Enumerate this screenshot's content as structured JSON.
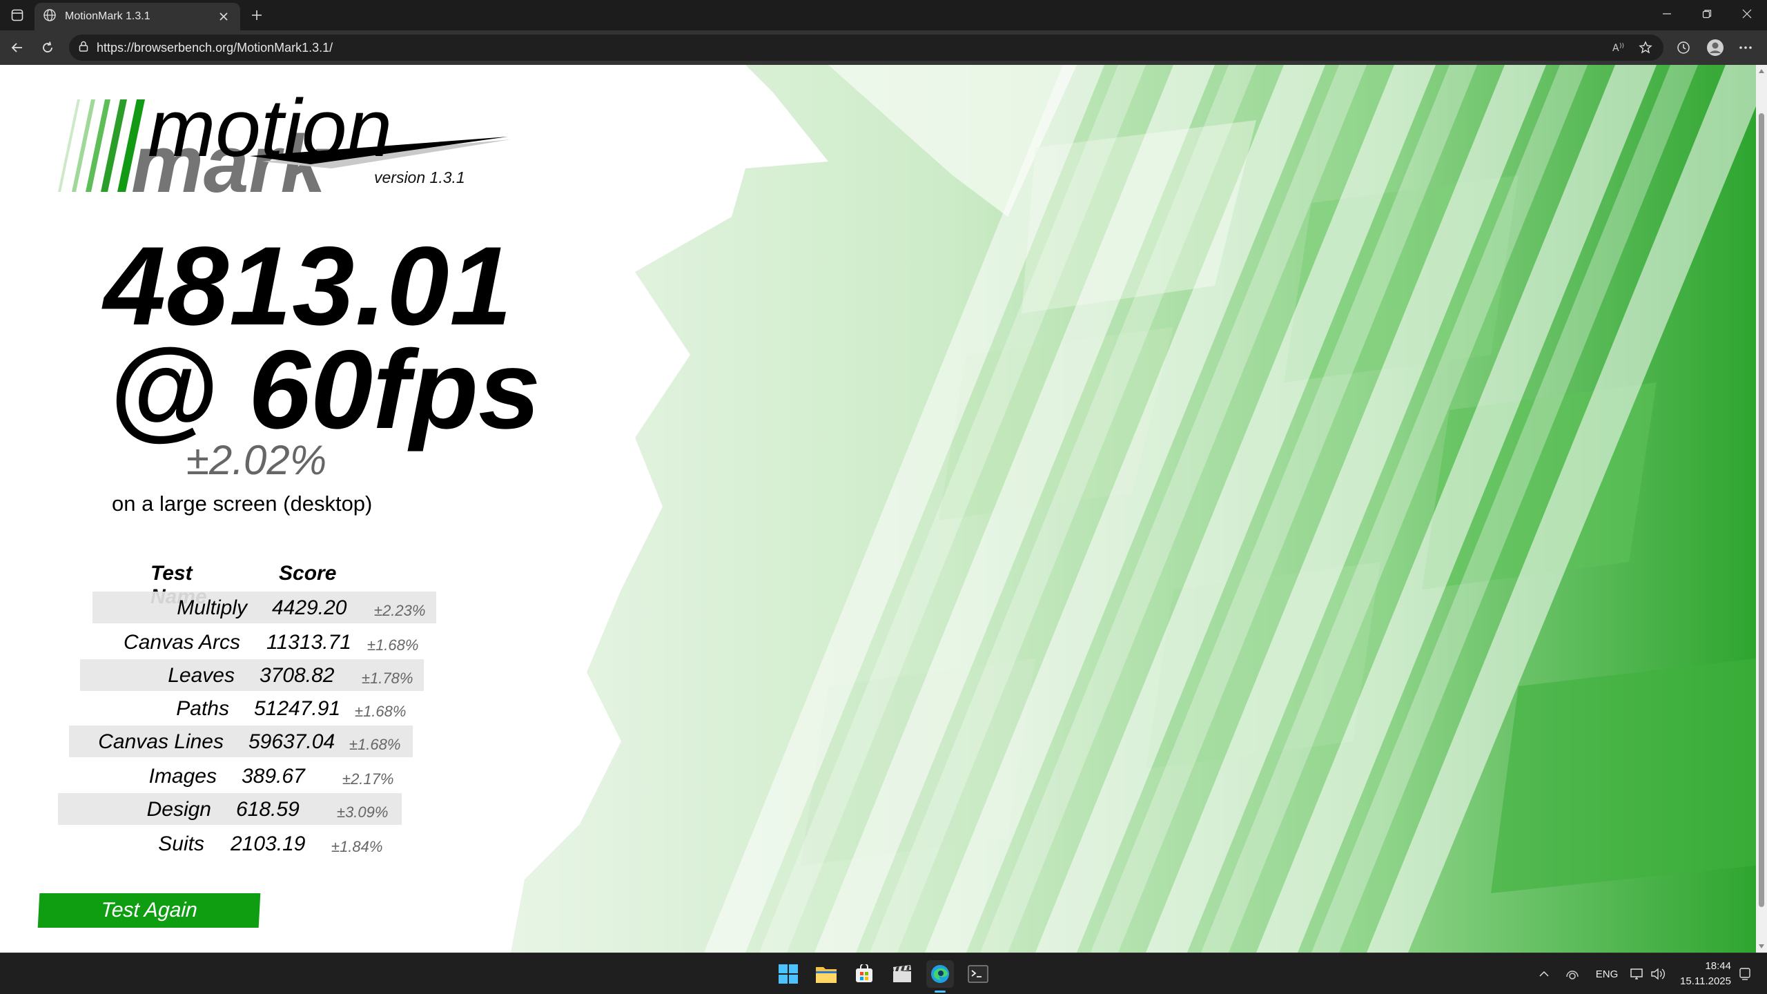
{
  "browser": {
    "tab_title": "MotionMark 1.3.1",
    "url": "https://browserbench.org/MotionMark1.3.1/"
  },
  "page": {
    "logo_word_1": "motion",
    "logo_word_2": "mark",
    "version": "version 1.3.1",
    "score": "4813.01",
    "fps": "@ 60fps",
    "confidence": "±2.02%",
    "screen_type": "on a large screen (desktop)",
    "table_headers": {
      "name": "Test Name",
      "score": "Score"
    },
    "results": [
      {
        "name": "Multiply",
        "score": "4429.20",
        "pct": "±2.23%"
      },
      {
        "name": "Canvas Arcs",
        "score": "11313.71",
        "pct": "±1.68%"
      },
      {
        "name": "Leaves",
        "score": "3708.82",
        "pct": "±1.78%"
      },
      {
        "name": "Paths",
        "score": "51247.91",
        "pct": "±1.68%"
      },
      {
        "name": "Canvas Lines",
        "score": "59637.04",
        "pct": "±1.68%"
      },
      {
        "name": "Images",
        "score": "389.67",
        "pct": "±2.17%"
      },
      {
        "name": "Design",
        "score": "618.59",
        "pct": "±3.09%"
      },
      {
        "name": "Suits",
        "score": "2103.19",
        "pct": "±1.84%"
      }
    ],
    "test_again_label": "Test Again"
  },
  "colors": {
    "accent_green": "#0f9e12",
    "art_green": "#2ea52f",
    "chrome_dark": "#1c1c1c",
    "toolbar": "#333333"
  },
  "taskbar": {
    "apps": [
      "start-icon",
      "file-explorer-icon",
      "store-icon",
      "clapper-icon",
      "edge-icon",
      "terminal-icon"
    ],
    "language": "ENG",
    "time": "18:44",
    "date": "15.11.2025"
  }
}
